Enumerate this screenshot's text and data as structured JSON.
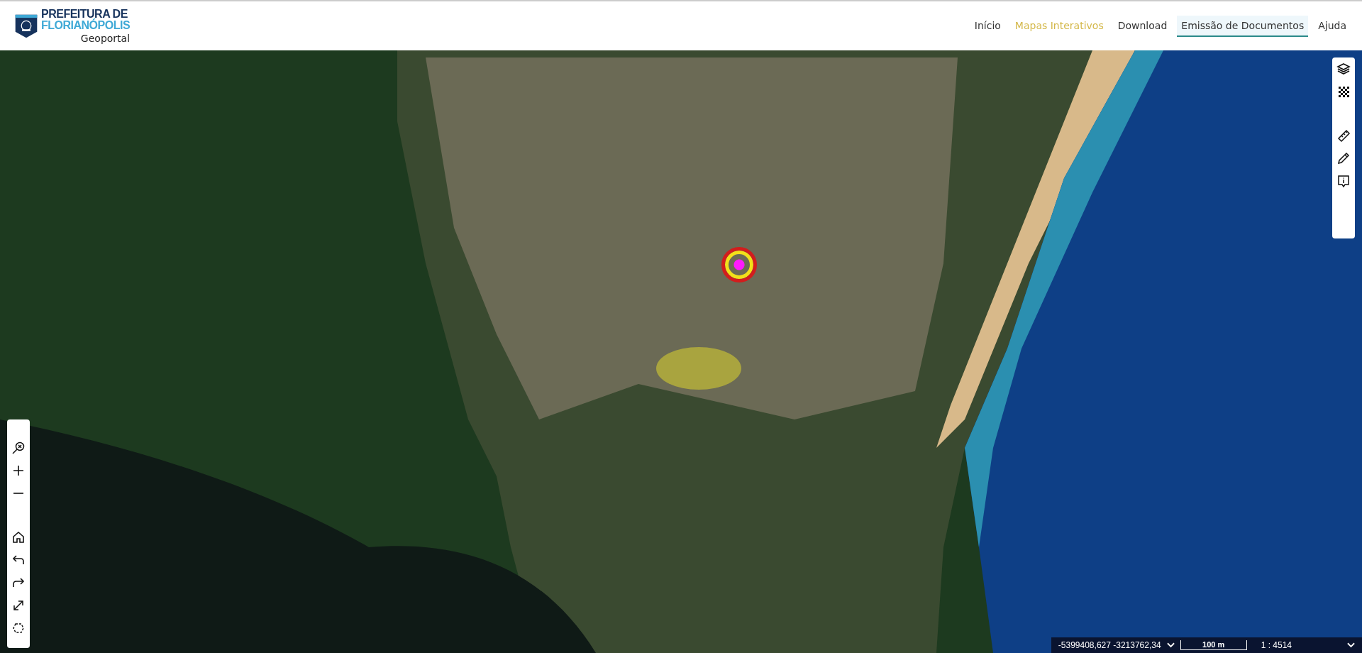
{
  "header": {
    "logo": {
      "line_1": "PREFEITURA DE",
      "line_2": "FLORIANÓPOLIS",
      "subtitle": "Geoportal"
    },
    "nav": [
      {
        "label": "Início",
        "selected": false,
        "highlighted": false
      },
      {
        "label": "Mapas Interativos",
        "selected": false,
        "highlighted": true
      },
      {
        "label": "Download",
        "selected": false,
        "highlighted": false
      },
      {
        "label": "Emissão de Documentos",
        "selected": true,
        "highlighted": false
      },
      {
        "label": "Ajuda",
        "selected": false,
        "highlighted": false
      }
    ]
  },
  "right_toolbar": [
    {
      "kind": "layers"
    },
    {
      "kind": "grid"
    },
    {
      "kind": "gap"
    },
    {
      "kind": "ruler"
    },
    {
      "kind": "pencil"
    },
    {
      "kind": "info"
    }
  ],
  "left_toolbar": [
    {
      "kind": "zoom-box"
    },
    {
      "kind": "plus"
    },
    {
      "kind": "minus"
    },
    {
      "kind": "gap"
    },
    {
      "kind": "home"
    },
    {
      "kind": "undo"
    },
    {
      "kind": "redo"
    },
    {
      "kind": "expand"
    },
    {
      "kind": "fit"
    }
  ],
  "status_bar": {
    "coordinates": "-5399408,627 -3213762,34",
    "scale_bar_label": "100 m",
    "scale_ratio": "1 : 4514"
  }
}
